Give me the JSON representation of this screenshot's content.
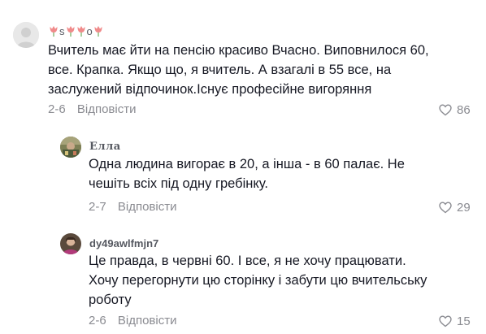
{
  "comments": [
    {
      "username_parts": [
        "s",
        "o"
      ],
      "text": "Вчитель має йти на пенсію красиво Вчасно. Виповнилося 60, все. Крапка. Якщо що, я вчитель. А взагалі в 55 все, на заслужений відпочинок.Існує професійне вигоряння",
      "date": "2-6",
      "reply_label": "Відповісти",
      "likes": "86",
      "avatar": "placeholder-avatar"
    },
    {
      "username": "Елла",
      "text": "Одна людина вигорає в 20, а інша - в 60 палає. Не чешіть всіх під одну гребінку.",
      "date": "2-7",
      "reply_label": "Відповісти",
      "likes": "29",
      "avatar": "photo-avatar"
    },
    {
      "username": "dy49awlfmjn7",
      "text": "Це правда, в червні 60. І все, я не хочу працювати. Хочу перегорнути цю сторінку і забути цю вчительську роботу",
      "date": "2-6",
      "reply_label": "Відповісти",
      "likes": "15",
      "avatar": "photo-avatar"
    }
  ],
  "icons": {
    "like": "heart-outline-icon",
    "username_decoration": "tulip-icon"
  },
  "colors": {
    "text": "#161823",
    "muted": "#8a8b91",
    "tulip": "#f08a8a"
  }
}
